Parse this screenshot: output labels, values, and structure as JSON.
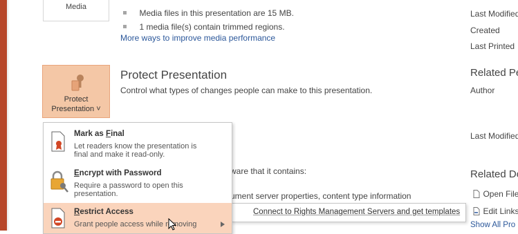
{
  "media_section": {
    "button_label": "Media",
    "bullets": [
      "Media files in this presentation are 15 MB.",
      "1 media file(s) contain trimmed regions."
    ],
    "link": "More ways to improve media performance"
  },
  "properties_panel": {
    "dates": [
      "Last Modified",
      "Created",
      "Last Printed"
    ],
    "related_people_heading": "Related Pe",
    "author_label": "Author",
    "last_modified_by": "Last Modified",
    "related_docs_heading": "Related Do",
    "open_file_location": "Open File",
    "edit_links": "Edit Links",
    "show_all": "Show All Pro"
  },
  "protect": {
    "button_line1": "Protect",
    "button_line2": "Presentation ˅",
    "heading": "Protect Presentation",
    "description": "Control what types of changes people can make to this presentation."
  },
  "inspect_partial": {
    "line1": "ware that it contains:",
    "line2": "ument server properties, content type information"
  },
  "protect_menu": {
    "items": [
      {
        "title_pre": "Mark as ",
        "title_key": "F",
        "title_post": "inal",
        "desc": "Let readers know the presentation is final and make it read-only.",
        "icon": "mark-final-icon"
      },
      {
        "title_pre": "",
        "title_key": "E",
        "title_post": "ncrypt with Password",
        "desc": "Require a password to open this presentation.",
        "icon": "lock-key-icon"
      },
      {
        "title_pre": "",
        "title_key": "R",
        "title_post": "estrict Access",
        "desc": "Grant people access while removing",
        "icon": "restrict-access-icon"
      }
    ]
  },
  "submenu": {
    "item": "Connect to Rights Management Servers and get templates"
  },
  "colors": {
    "accent": "#b7472a",
    "highlight": "#fad4bc",
    "link": "#2b579a"
  }
}
